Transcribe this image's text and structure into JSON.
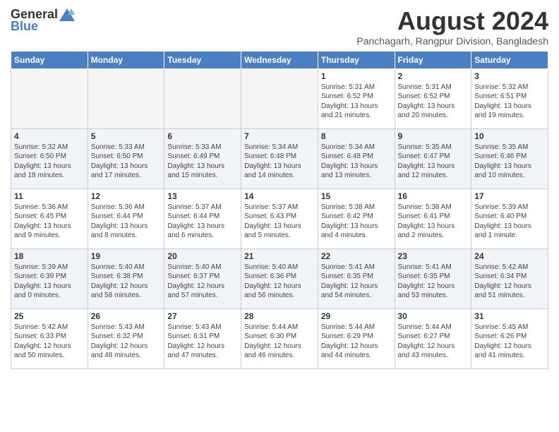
{
  "header": {
    "logo_general": "General",
    "logo_blue": "Blue",
    "month_year": "August 2024",
    "location": "Panchagarh, Rangpur Division, Bangladesh"
  },
  "weekdays": [
    "Sunday",
    "Monday",
    "Tuesday",
    "Wednesday",
    "Thursday",
    "Friday",
    "Saturday"
  ],
  "weeks": [
    [
      {
        "day": "",
        "info": "",
        "empty": true
      },
      {
        "day": "",
        "info": "",
        "empty": true
      },
      {
        "day": "",
        "info": "",
        "empty": true
      },
      {
        "day": "",
        "info": "",
        "empty": true
      },
      {
        "day": "1",
        "info": "Sunrise: 5:31 AM\nSunset: 6:52 PM\nDaylight: 13 hours\nand 21 minutes."
      },
      {
        "day": "2",
        "info": "Sunrise: 5:31 AM\nSunset: 6:52 PM\nDaylight: 13 hours\nand 20 minutes."
      },
      {
        "day": "3",
        "info": "Sunrise: 5:32 AM\nSunset: 6:51 PM\nDaylight: 13 hours\nand 19 minutes."
      }
    ],
    [
      {
        "day": "4",
        "info": "Sunrise: 5:32 AM\nSunset: 6:50 PM\nDaylight: 13 hours\nand 18 minutes."
      },
      {
        "day": "5",
        "info": "Sunrise: 5:33 AM\nSunset: 6:50 PM\nDaylight: 13 hours\nand 17 minutes."
      },
      {
        "day": "6",
        "info": "Sunrise: 5:33 AM\nSunset: 6:49 PM\nDaylight: 13 hours\nand 15 minutes."
      },
      {
        "day": "7",
        "info": "Sunrise: 5:34 AM\nSunset: 6:48 PM\nDaylight: 13 hours\nand 14 minutes."
      },
      {
        "day": "8",
        "info": "Sunrise: 5:34 AM\nSunset: 6:48 PM\nDaylight: 13 hours\nand 13 minutes."
      },
      {
        "day": "9",
        "info": "Sunrise: 5:35 AM\nSunset: 6:47 PM\nDaylight: 13 hours\nand 12 minutes."
      },
      {
        "day": "10",
        "info": "Sunrise: 5:35 AM\nSunset: 6:46 PM\nDaylight: 13 hours\nand 10 minutes."
      }
    ],
    [
      {
        "day": "11",
        "info": "Sunrise: 5:36 AM\nSunset: 6:45 PM\nDaylight: 13 hours\nand 9 minutes."
      },
      {
        "day": "12",
        "info": "Sunrise: 5:36 AM\nSunset: 6:44 PM\nDaylight: 13 hours\nand 8 minutes."
      },
      {
        "day": "13",
        "info": "Sunrise: 5:37 AM\nSunset: 6:44 PM\nDaylight: 13 hours\nand 6 minutes."
      },
      {
        "day": "14",
        "info": "Sunrise: 5:37 AM\nSunset: 6:43 PM\nDaylight: 13 hours\nand 5 minutes."
      },
      {
        "day": "15",
        "info": "Sunrise: 5:38 AM\nSunset: 6:42 PM\nDaylight: 13 hours\nand 4 minutes."
      },
      {
        "day": "16",
        "info": "Sunrise: 5:38 AM\nSunset: 6:41 PM\nDaylight: 13 hours\nand 2 minutes."
      },
      {
        "day": "17",
        "info": "Sunrise: 5:39 AM\nSunset: 6:40 PM\nDaylight: 13 hours\nand 1 minute."
      }
    ],
    [
      {
        "day": "18",
        "info": "Sunrise: 5:39 AM\nSunset: 6:39 PM\nDaylight: 13 hours\nand 0 minutes."
      },
      {
        "day": "19",
        "info": "Sunrise: 5:40 AM\nSunset: 6:38 PM\nDaylight: 12 hours\nand 58 minutes."
      },
      {
        "day": "20",
        "info": "Sunrise: 5:40 AM\nSunset: 6:37 PM\nDaylight: 12 hours\nand 57 minutes."
      },
      {
        "day": "21",
        "info": "Sunrise: 5:40 AM\nSunset: 6:36 PM\nDaylight: 12 hours\nand 56 minutes."
      },
      {
        "day": "22",
        "info": "Sunrise: 5:41 AM\nSunset: 6:35 PM\nDaylight: 12 hours\nand 54 minutes."
      },
      {
        "day": "23",
        "info": "Sunrise: 5:41 AM\nSunset: 6:35 PM\nDaylight: 12 hours\nand 53 minutes."
      },
      {
        "day": "24",
        "info": "Sunrise: 5:42 AM\nSunset: 6:34 PM\nDaylight: 12 hours\nand 51 minutes."
      }
    ],
    [
      {
        "day": "25",
        "info": "Sunrise: 5:42 AM\nSunset: 6:33 PM\nDaylight: 12 hours\nand 50 minutes."
      },
      {
        "day": "26",
        "info": "Sunrise: 5:43 AM\nSunset: 6:32 PM\nDaylight: 12 hours\nand 48 minutes."
      },
      {
        "day": "27",
        "info": "Sunrise: 5:43 AM\nSunset: 6:31 PM\nDaylight: 12 hours\nand 47 minutes."
      },
      {
        "day": "28",
        "info": "Sunrise: 5:44 AM\nSunset: 6:30 PM\nDaylight: 12 hours\nand 46 minutes."
      },
      {
        "day": "29",
        "info": "Sunrise: 5:44 AM\nSunset: 6:29 PM\nDaylight: 12 hours\nand 44 minutes."
      },
      {
        "day": "30",
        "info": "Sunrise: 5:44 AM\nSunset: 6:27 PM\nDaylight: 12 hours\nand 43 minutes."
      },
      {
        "day": "31",
        "info": "Sunrise: 5:45 AM\nSunset: 6:26 PM\nDaylight: 12 hours\nand 41 minutes."
      }
    ]
  ]
}
